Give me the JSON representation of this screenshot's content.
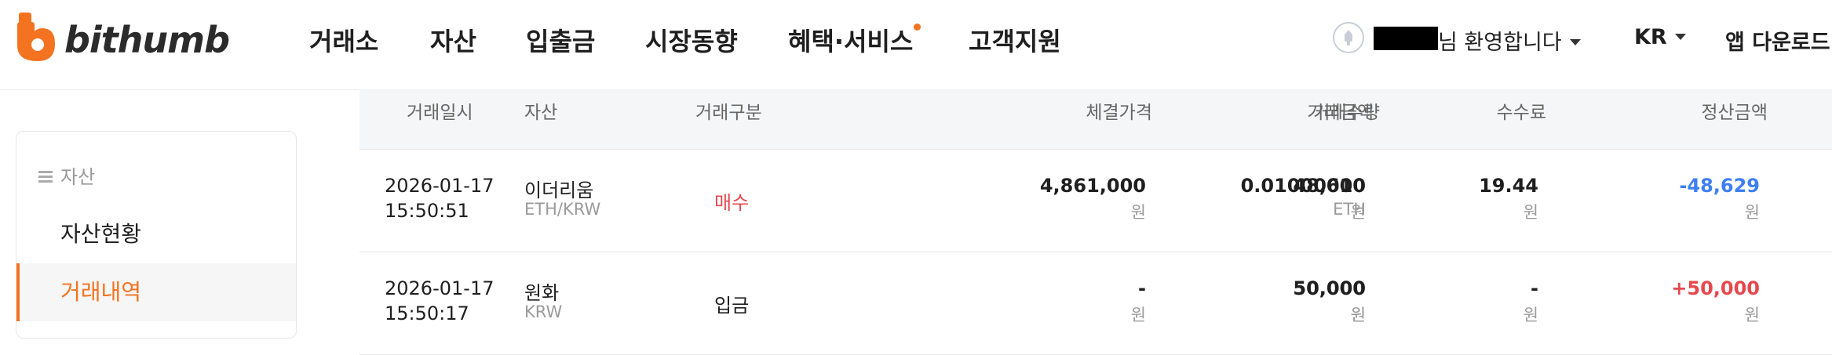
{
  "brand": {
    "name": "bithumb",
    "logo_color": "#f37321"
  },
  "nav": [
    {
      "label": "거래소"
    },
    {
      "label": "자산"
    },
    {
      "label": "입출금"
    },
    {
      "label": "시장동향"
    },
    {
      "label": "혜택·서비스",
      "dot": true
    },
    {
      "label": "고객지원"
    }
  ],
  "user": {
    "welcome": "님 환영합니다",
    "lang": "KR",
    "app_download": "앱 다운로드"
  },
  "sidebar": {
    "section": "자산",
    "items": [
      {
        "label": "자산현황",
        "active": false
      },
      {
        "label": "거래내역",
        "active": true
      }
    ]
  },
  "table": {
    "headers": [
      "거래일시",
      "자산",
      "거래구분",
      "거래수량",
      "체결가격",
      "거래금액",
      "수수료",
      "정산금액"
    ],
    "rows": [
      {
        "date": "2026-01-17",
        "time": "15:50:51",
        "asset": "이더리움",
        "pair": "ETH/KRW",
        "type": "매수",
        "qty": "0.01000000",
        "qty_unit": "ETH",
        "price": "4,861,000",
        "price_unit": "원",
        "amount": "48,610",
        "amount_unit": "원",
        "fee": "19.44",
        "fee_unit": "원",
        "settle": "-48,629",
        "settle_unit": "원"
      },
      {
        "date": "2026-01-17",
        "time": "15:50:17",
        "asset": "원화",
        "pair": "KRW",
        "type": "입금",
        "qty": "50,000",
        "qty_unit": "원",
        "price": "-",
        "price_unit": "원",
        "amount": "50,000",
        "amount_unit": "원",
        "fee": "-",
        "fee_unit": "원",
        "settle": "+50,000",
        "settle_unit": "원"
      }
    ]
  },
  "colors": {
    "accent": "#f37321",
    "negative": "#3d7ff0",
    "positive": "#e5484d"
  },
  "icons": [
    "logo-icon",
    "avatar-icon",
    "caret-down-icon",
    "menu-icon"
  ]
}
